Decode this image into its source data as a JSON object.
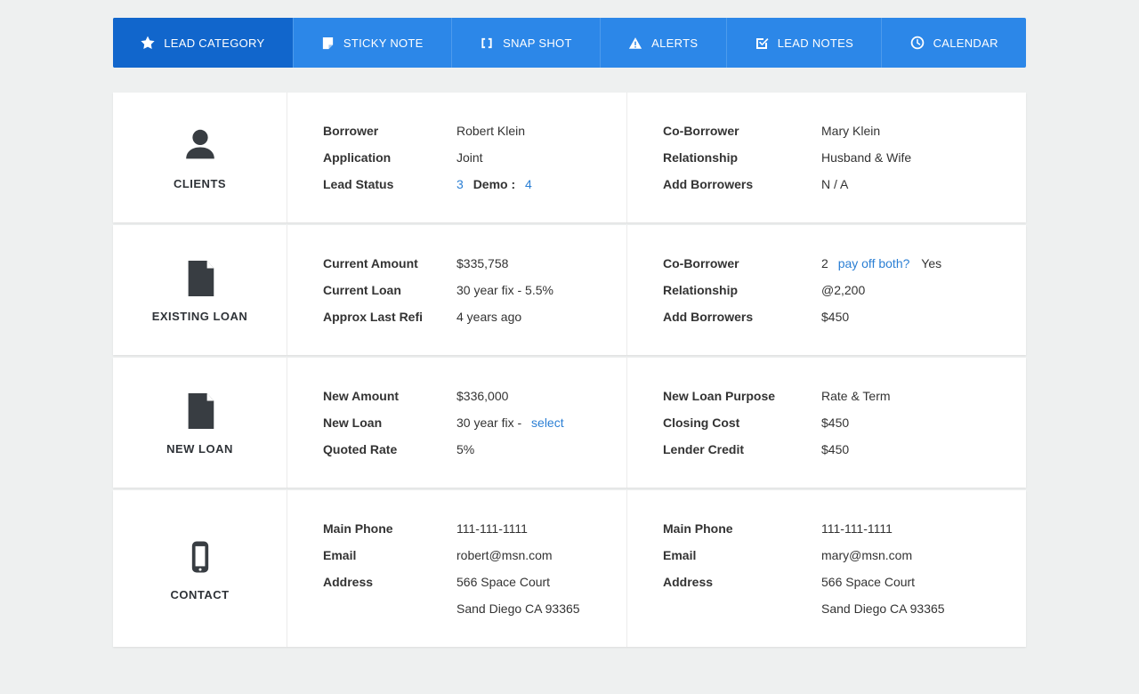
{
  "tabs": [
    {
      "label": "LEAD CATEGORY",
      "icon": "star-icon",
      "active": true
    },
    {
      "label": "STICKY NOTE",
      "icon": "sticky-note-icon",
      "active": false
    },
    {
      "label": "SNAP SHOT",
      "icon": "snapshot-brackets-icon",
      "active": false
    },
    {
      "label": "ALERTS",
      "icon": "alert-triangle-icon",
      "active": false
    },
    {
      "label": "LEAD NOTES",
      "icon": "lead-notes-icon",
      "active": false
    },
    {
      "label": "CALENDAR",
      "icon": "clock-icon",
      "active": false
    }
  ],
  "sections": [
    {
      "name": "CLIENTS",
      "icon": "person-icon",
      "left": [
        {
          "label": "Borrower",
          "value": "Robert Klein"
        },
        {
          "label": "Application",
          "value": "Joint"
        },
        {
          "label": "Lead Status",
          "link1": "3",
          "mid": "Demo :",
          "link2": "4"
        }
      ],
      "right": [
        {
          "label": "Co-Borrower",
          "value": "Mary Klein"
        },
        {
          "label": "Relationship",
          "value": "Husband & Wife"
        },
        {
          "label": "Add Borrowers",
          "value": "N / A"
        }
      ]
    },
    {
      "name": "EXISTING LOAN",
      "icon": "document-icon",
      "left": [
        {
          "label": "Current Amount",
          "value": "$335,758"
        },
        {
          "label": "Current Loan",
          "value": "30 year fix - 5.5%"
        },
        {
          "label": "Approx Last Refi",
          "value": "4 years ago"
        }
      ],
      "right": [
        {
          "label": "Co-Borrower",
          "pre": "2",
          "link": "pay off both?",
          "post": "Yes"
        },
        {
          "label": "Relationship",
          "value": "@2,200"
        },
        {
          "label": "Add Borrowers",
          "value": "$450"
        }
      ]
    },
    {
      "name": "NEW LOAN",
      "icon": "document-icon",
      "left": [
        {
          "label": "New Amount",
          "value": "$336,000"
        },
        {
          "label": "New Loan",
          "pre": "30 year fix -",
          "link": "select"
        },
        {
          "label": "Quoted Rate",
          "value": "5%"
        }
      ],
      "right": [
        {
          "label": "New Loan Purpose",
          "value": "Rate & Term"
        },
        {
          "label": "Closing Cost",
          "value": "$450"
        },
        {
          "label": "Lender Credit",
          "value": "$450"
        }
      ]
    },
    {
      "name": "CONTACT",
      "icon": "phone-icon",
      "left": [
        {
          "label": "Main Phone",
          "value": "111-111-1111"
        },
        {
          "label": "Email",
          "value": "robert@msn.com"
        },
        {
          "label": "Address",
          "value": "566 Space Court"
        },
        {
          "label": "",
          "value": "Sand Diego CA 93365"
        }
      ],
      "right": [
        {
          "label": "Main Phone",
          "value": "111-111-1111"
        },
        {
          "label": "Email",
          "value": "mary@msn.com"
        },
        {
          "label": "Address",
          "value": "566 Space Court"
        },
        {
          "label": "",
          "value": "Sand Diego CA 93365"
        }
      ]
    }
  ],
  "colors": {
    "tab_bar": "#2c87e8",
    "tab_active": "#1166cc",
    "link": "#2b7fd4",
    "text": "#333333",
    "icon": "#383d42",
    "page_background": "#eef0f0"
  }
}
